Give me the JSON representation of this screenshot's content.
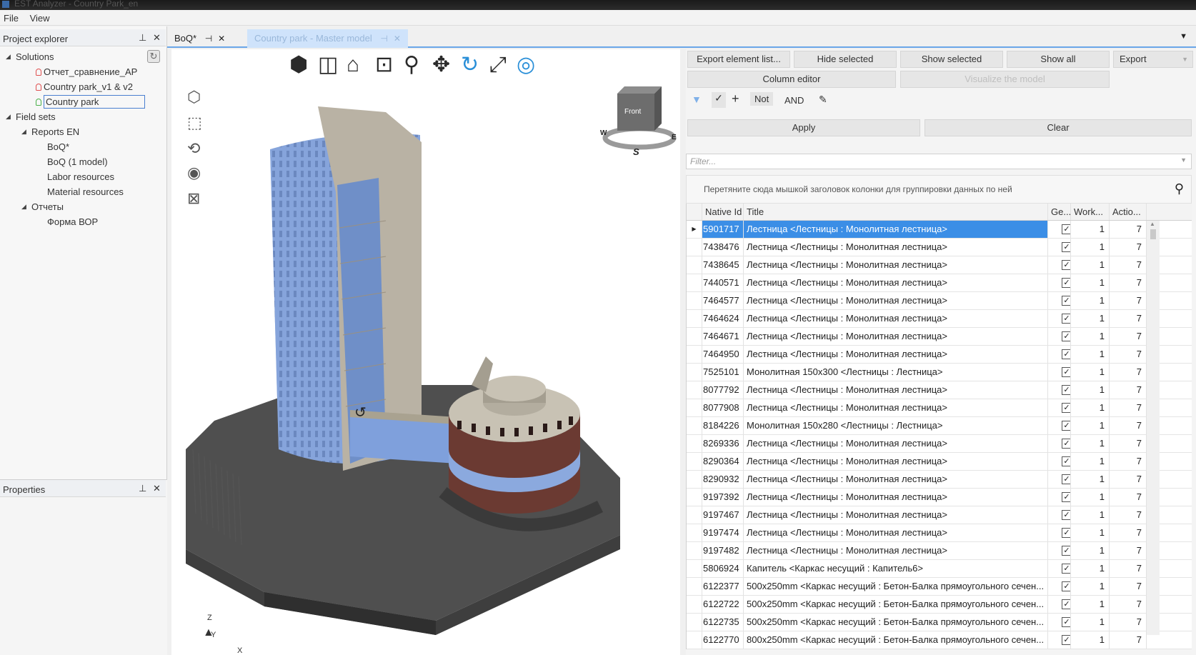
{
  "window": {
    "title": "EST Analyzer - Country Park_en"
  },
  "menu": [
    "File",
    "View"
  ],
  "project_explorer": {
    "title": "Project explorer",
    "tree": [
      {
        "label": "Solutions",
        "level": 0,
        "arrow": "◢"
      },
      {
        "label": "Отчет_сравнение_АР",
        "level": 2,
        "icon": "bulb-red"
      },
      {
        "label": "Country park_v1 & v2",
        "level": 2,
        "icon": "bulb-red"
      },
      {
        "label": "Country park",
        "level": 2,
        "icon": "bulb-green",
        "selected": true
      },
      {
        "label": "Field sets",
        "level": 0,
        "arrow": "◢"
      },
      {
        "label": "Reports EN",
        "level": 1,
        "arrow": "◢"
      },
      {
        "label": "BoQ*",
        "level": 3
      },
      {
        "label": "BoQ (1 model)",
        "level": 3
      },
      {
        "label": "Labor resources",
        "level": 3
      },
      {
        "label": "Material resources",
        "level": 3
      },
      {
        "label": "Отчеты",
        "level": 1,
        "arrow": "◢"
      },
      {
        "label": "Форма ВОР",
        "level": 3
      }
    ]
  },
  "properties": {
    "title": "Properties"
  },
  "tabs": [
    {
      "label": "BoQ*"
    },
    {
      "label": "Country park - Master model",
      "active": true
    }
  ],
  "viewer": {
    "cube_face": "Front",
    "compass": {
      "w": "W",
      "e": "E",
      "s": "S"
    },
    "axes": {
      "z": "Z",
      "y": "Y",
      "x": "X"
    }
  },
  "right": {
    "buttons": {
      "export_list": "Export element list...",
      "hide_selected": "Hide selected",
      "show_selected": "Show selected",
      "show_all": "Show all",
      "export": "Export",
      "column_editor": "Column editor",
      "visualize": "Visualize the model",
      "apply": "Apply",
      "clear": "Clear"
    },
    "filter_ops": {
      "not": "Not",
      "and": "AND"
    },
    "filter_placeholder": "Filter...",
    "group_hint": "Перетяните сюда мышкой заголовок колонки для группировки данных по ней",
    "columns": {
      "id": "Native Id",
      "title": "Title",
      "ge": "Ge...",
      "work": "Work...",
      "act": "Actio..."
    },
    "rows": [
      {
        "id": "5901717",
        "title": "Лестница <Лестницы : Монолитная лестница>",
        "work": "1",
        "act": "7"
      },
      {
        "id": "7438476",
        "title": "Лестница <Лестницы : Монолитная лестница>",
        "work": "1",
        "act": "7"
      },
      {
        "id": "7438645",
        "title": "Лестница <Лестницы : Монолитная лестница>",
        "work": "1",
        "act": "7"
      },
      {
        "id": "7440571",
        "title": "Лестница <Лестницы : Монолитная лестница>",
        "work": "1",
        "act": "7"
      },
      {
        "id": "7464577",
        "title": "Лестница <Лестницы : Монолитная лестница>",
        "work": "1",
        "act": "7"
      },
      {
        "id": "7464624",
        "title": "Лестница <Лестницы : Монолитная лестница>",
        "work": "1",
        "act": "7"
      },
      {
        "id": "7464671",
        "title": "Лестница <Лестницы : Монолитная лестница>",
        "work": "1",
        "act": "7"
      },
      {
        "id": "7464950",
        "title": "Лестница <Лестницы : Монолитная лестница>",
        "work": "1",
        "act": "7"
      },
      {
        "id": "7525101",
        "title": "Монолитная 150x300 <Лестницы : Лестница>",
        "work": "1",
        "act": "7"
      },
      {
        "id": "8077792",
        "title": "Лестница <Лестницы : Монолитная лестница>",
        "work": "1",
        "act": "7"
      },
      {
        "id": "8077908",
        "title": "Лестница <Лестницы : Монолитная лестница>",
        "work": "1",
        "act": "7"
      },
      {
        "id": "8184226",
        "title": "Монолитная 150x280 <Лестницы : Лестница>",
        "work": "1",
        "act": "7"
      },
      {
        "id": "8269336",
        "title": "Лестница <Лестницы : Монолитная лестница>",
        "work": "1",
        "act": "7"
      },
      {
        "id": "8290364",
        "title": "Лестница <Лестницы : Монолитная лестница>",
        "work": "1",
        "act": "7"
      },
      {
        "id": "8290932",
        "title": "Лестница <Лестницы : Монолитная лестница>",
        "work": "1",
        "act": "7"
      },
      {
        "id": "9197392",
        "title": "Лестница <Лестницы : Монолитная лестница>",
        "work": "1",
        "act": "7"
      },
      {
        "id": "9197467",
        "title": "Лестница <Лестницы : Монолитная лестница>",
        "work": "1",
        "act": "7"
      },
      {
        "id": "9197474",
        "title": "Лестница <Лестницы : Монолитная лестница>",
        "work": "1",
        "act": "7"
      },
      {
        "id": "9197482",
        "title": "Лестница <Лестницы : Монолитная лестница>",
        "work": "1",
        "act": "7"
      },
      {
        "id": "5806924",
        "title": "Капитель <Каркас несущий : Капитель6>",
        "work": "1",
        "act": "7"
      },
      {
        "id": "6122377",
        "title": "500x250mm <Каркас несущий : Бетон-Балка прямоугольного сечен...",
        "work": "1",
        "act": "7"
      },
      {
        "id": "6122722",
        "title": "500x250mm <Каркас несущий : Бетон-Балка прямоугольного сечен...",
        "work": "1",
        "act": "7"
      },
      {
        "id": "6122735",
        "title": "500x250mm <Каркас несущий : Бетон-Балка прямоугольного сечен...",
        "work": "1",
        "act": "7"
      },
      {
        "id": "6122770",
        "title": "800x250mm <Каркас несущий : Бетон-Балка прямоугольного сечен...",
        "work": "1",
        "act": "7"
      }
    ]
  },
  "colors": {
    "accent": "#3b8ee6",
    "glass": "#7f9fd6",
    "concrete": "#5a5a5a",
    "brick": "#6b3a32"
  }
}
